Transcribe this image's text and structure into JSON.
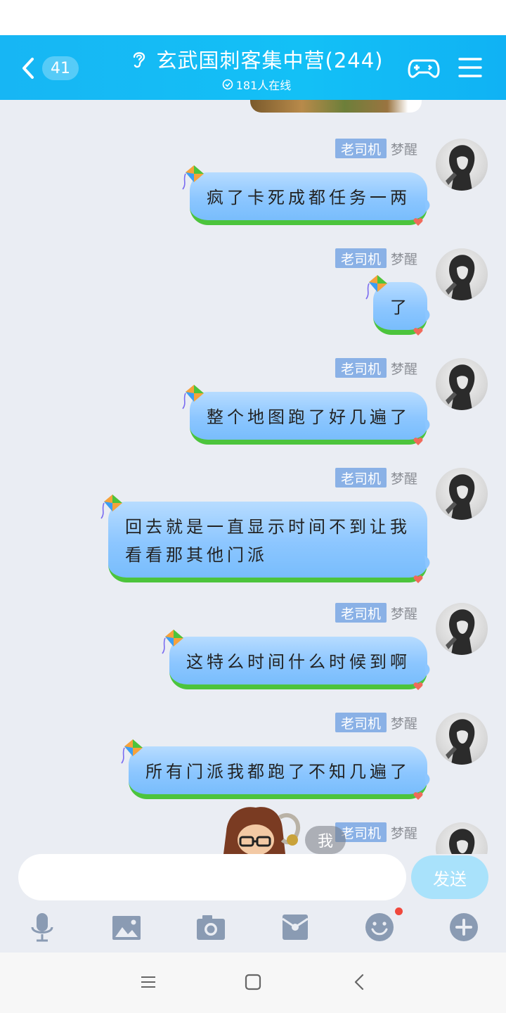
{
  "header": {
    "back_count": "41",
    "title": "玄武国刺客集中营(244)",
    "online": "181人在线"
  },
  "messages": [
    {
      "tag": "老司机",
      "nick": "梦醒",
      "lines": [
        "疯了卡死成都任务一两"
      ]
    },
    {
      "tag": "老司机",
      "nick": "梦醒",
      "lines": [
        "了"
      ]
    },
    {
      "tag": "老司机",
      "nick": "梦醒",
      "lines": [
        "整个地图跑了好几遍了"
      ]
    },
    {
      "tag": "老司机",
      "nick": "梦醒",
      "lines": [
        "回去就是一直显示时间不到让我",
        "看看那其他门派"
      ]
    },
    {
      "tag": "老司机",
      "nick": "梦醒",
      "lines": [
        "这特么时间什么时候到啊"
      ]
    },
    {
      "tag": "老司机",
      "nick": "梦醒",
      "lines": [
        "所有门派我都跑了不知几遍了"
      ]
    },
    {
      "tag": "老司机",
      "nick": "梦醒",
      "lines": []
    }
  ],
  "me_badge": "我",
  "input": {
    "value": "",
    "placeholder": "",
    "send_label": "发送"
  },
  "toolbar": [
    "mic-icon",
    "image-icon",
    "camera-icon",
    "red-packet-icon",
    "emoji-icon",
    "plus-icon"
  ],
  "colors": {
    "header": "#13bbf6",
    "bubble": "#8cc6ff",
    "tag": "#8ab1e6",
    "send": "#a9e2fb",
    "chat_bg": "#eaedf3"
  }
}
